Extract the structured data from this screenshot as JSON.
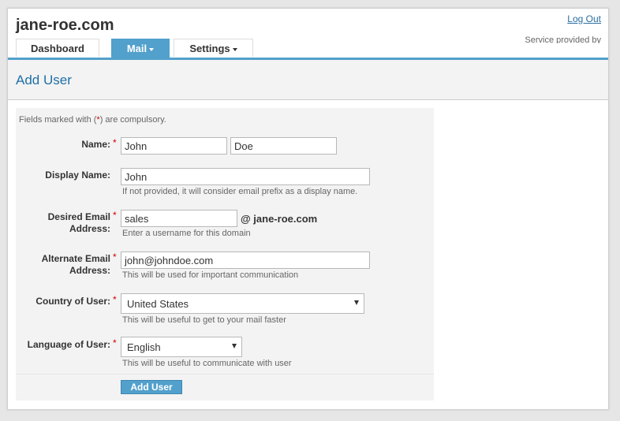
{
  "header": {
    "site_title": "jane-roe.com",
    "logout_label": "Log Out",
    "service_text": "Service provided by"
  },
  "tabs": [
    {
      "label": "Dashboard",
      "has_dropdown": false,
      "active": false
    },
    {
      "label": "Mail",
      "has_dropdown": true,
      "active": true
    },
    {
      "label": "Settings",
      "has_dropdown": true,
      "active": false
    }
  ],
  "page": {
    "title": "Add User"
  },
  "form": {
    "note_prefix": "Fields marked with (",
    "note_star": "*",
    "note_suffix": ") are compulsory.",
    "required_marker": "*",
    "name": {
      "label": "Name:",
      "first_value": "John",
      "last_value": "Doe"
    },
    "display_name": {
      "label": "Display Name:",
      "value": "John",
      "hint": "If not provided, it will consider email prefix as a display name."
    },
    "desired_email": {
      "label_line1": "Desired Email",
      "label_line2": "Address:",
      "value": "sales",
      "domain": "@ jane-roe.com",
      "hint": "Enter a username for this domain"
    },
    "alternate_email": {
      "label_line1": "Alternate Email",
      "label_line2": "Address:",
      "value": "john@johndoe.com",
      "hint": "This will be used for important communication"
    },
    "country": {
      "label": "Country of User:",
      "value": "United States",
      "hint": "This will be useful to get to your mail faster"
    },
    "language": {
      "label": "Language of User:",
      "value": "English",
      "hint": "This will be useful to communicate with user"
    },
    "submit_label": "Add User"
  },
  "colors": {
    "accent": "#52a0cc",
    "title_blue": "#1f6fa5",
    "required_red": "#cc0000"
  }
}
